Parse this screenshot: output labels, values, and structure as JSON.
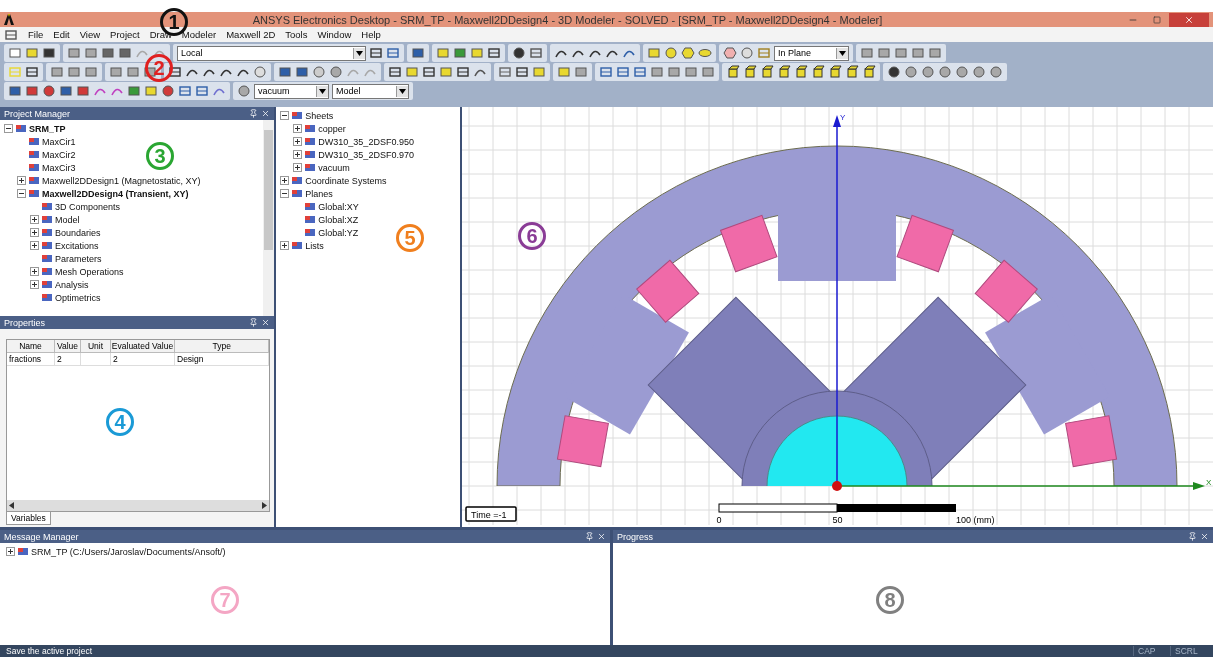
{
  "window": {
    "title": "ANSYS Electronics Desktop - SRM_TP - Maxwell2DDesign4 - 3D Modeler - SOLVED - [SRM_TP - Maxwell2DDesign4 - Modeler]"
  },
  "menu": [
    "File",
    "Edit",
    "View",
    "Project",
    "Draw",
    "Modeler",
    "Maxwell 2D",
    "Tools",
    "Window",
    "Help"
  ],
  "toolbar": {
    "coordinate_system": "Local",
    "plane_mode": "In Plane",
    "material": "vacuum",
    "object_type": "Model"
  },
  "project_manager": {
    "title": "Project Manager",
    "tree": [
      {
        "label": "SRM_TP",
        "expanded": true,
        "active": true,
        "children": [
          {
            "label": "MaxCir1",
            "active": false
          },
          {
            "label": "MaxCir2",
            "active": false
          },
          {
            "label": "MaxCir3",
            "active": false
          },
          {
            "label": "Maxwell2DDesign1 (Magnetostatic, XY)",
            "expanded": false,
            "active": false
          },
          {
            "label": "Maxwell2DDesign4 (Transient, XY)",
            "expanded": true,
            "active": true,
            "children": [
              {
                "label": "3D Components",
                "active": false
              },
              {
                "label": "Model",
                "expanded": false,
                "active": false
              },
              {
                "label": "Boundaries",
                "expanded": false,
                "active": false
              },
              {
                "label": "Excitations",
                "expanded": false,
                "active": false
              },
              {
                "label": "Parameters",
                "active": false
              },
              {
                "label": "Mesh Operations",
                "expanded": false,
                "active": false
              },
              {
                "label": "Analysis",
                "expanded": false,
                "active": false
              },
              {
                "label": "Optimetrics",
                "active": false
              }
            ]
          }
        ]
      }
    ]
  },
  "properties": {
    "title": "Properties",
    "columns": [
      "Name",
      "Value",
      "Unit",
      "Evaluated Value",
      "Type"
    ],
    "rows": [
      {
        "name": "fractions",
        "value": "2",
        "evaluated_value": "2",
        "type": "Design"
      }
    ],
    "tabs": [
      {
        "label": "Variables",
        "selected": true
      }
    ]
  },
  "model_tree": [
    {
      "label": "Sheets",
      "expanded": true,
      "children": [
        {
          "label": "copper",
          "expanded": false
        },
        {
          "label": "DW310_35_2DSF0.950",
          "expanded": false
        },
        {
          "label": "DW310_35_2DSF0.970",
          "expanded": false
        },
        {
          "label": "vacuum",
          "expanded": false
        }
      ]
    },
    {
      "label": "Coordinate Systems",
      "expanded": false
    },
    {
      "label": "Planes",
      "expanded": true,
      "children": [
        {
          "label": "Global:XY"
        },
        {
          "label": "Global:XZ"
        },
        {
          "label": "Global:YZ"
        }
      ]
    },
    {
      "label": "Lists",
      "expanded": false
    }
  ],
  "viewport": {
    "x_axis": "X",
    "y_axis": "Y",
    "time": "Time =-1",
    "scale": [
      "0",
      "50",
      "100 (mm)"
    ]
  },
  "message_manager": {
    "title": "Message Manager",
    "items": [
      {
        "label": "SRM_TP (C:/Users/Jaroslav/Documents/Ansoft/)",
        "expanded": false
      }
    ]
  },
  "progress": {
    "title": "Progress"
  },
  "status_bar": {
    "message": "Save the active project",
    "indicators": [
      {
        "label": "CAP",
        "on": false
      },
      {
        "label": "SCRL",
        "on": false
      }
    ]
  },
  "callouts": [
    {
      "label": "1",
      "color": "#111111"
    },
    {
      "label": "2",
      "color": "#e02020"
    },
    {
      "label": "3",
      "color": "#2aa632"
    },
    {
      "label": "4",
      "color": "#1a9ad6"
    },
    {
      "label": "5",
      "color": "#f07f1e"
    },
    {
      "label": "6",
      "color": "#8a3c96"
    },
    {
      "label": "7",
      "color": "#f4a6c4"
    },
    {
      "label": "8",
      "color": "#808080"
    }
  ]
}
